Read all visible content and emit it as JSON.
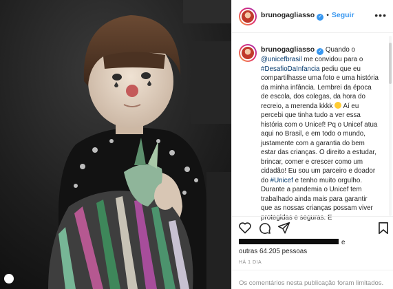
{
  "post": {
    "username": "brunogagliasso",
    "follow_label": "Seguir",
    "more_label": "•••",
    "caption_parts": {
      "p1": "Quando o ",
      "mention": "@unicefbrasil",
      "p2": " me convidou para o ",
      "hashtag1": "#DesafioDaInfancia",
      "p3": " pediu que eu compartilhasse uma foto e uma história da minha infância. Lembrei da época de escola, dos colegas, da hora do recreio, a merenda kkkk ",
      "p4": " Aí eu percebi que tinha tudo a ver essa história com o Unicef! Pq o Unicef atua aqui no Brasil, e em todo o mundo, justamente com a garantia do bem estar das crianças. O direito a estudar, brincar, comer e crescer como um cidadão! Eu sou um parceiro e doador do ",
      "hashtag2": "#Unicef",
      "p5": " e tenho muito orgulho. Durante a pandemia o Unicef tem trabalhado ainda mais para garantir que as nossas crianças possam viver protegidas e seguras. E"
    },
    "likes_suffix": "e",
    "likes_others_prefix": "outras ",
    "likes_count": "64.205",
    "likes_unit": " pessoas",
    "time_ago": "HÁ 1 DIA",
    "comments_notice": "Os comentários nesta publicação foram limitados."
  },
  "icons": {
    "heart": "heart-icon",
    "comment": "comment-icon",
    "share": "share-icon",
    "save": "bookmark-icon",
    "verified": "verified-badge-icon",
    "photo_counter": "photo-counter-icon"
  },
  "colors": {
    "link": "#3897f0",
    "hashtag": "#00376b",
    "muted": "#8e8e8e"
  }
}
